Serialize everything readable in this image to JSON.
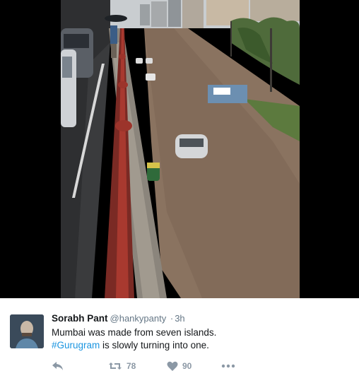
{
  "tweet": {
    "author_name": "Sorabh Pant",
    "handle": "@hankypanty",
    "separator": "·",
    "timestamp": "3h",
    "line1": "Mumbai was made from seven islands.",
    "hashtag": "#Gurugram",
    "line2_rest": " is slowly turning into one."
  },
  "actions": {
    "retweets": "78",
    "likes": "90"
  },
  "icons": {
    "reply": "reply-icon",
    "retweet": "retweet-icon",
    "like": "heart-icon",
    "more": "more-icon"
  },
  "colors": {
    "hashtag": "#1b95e0",
    "muted": "#657786",
    "icon": "#8b98a5"
  }
}
